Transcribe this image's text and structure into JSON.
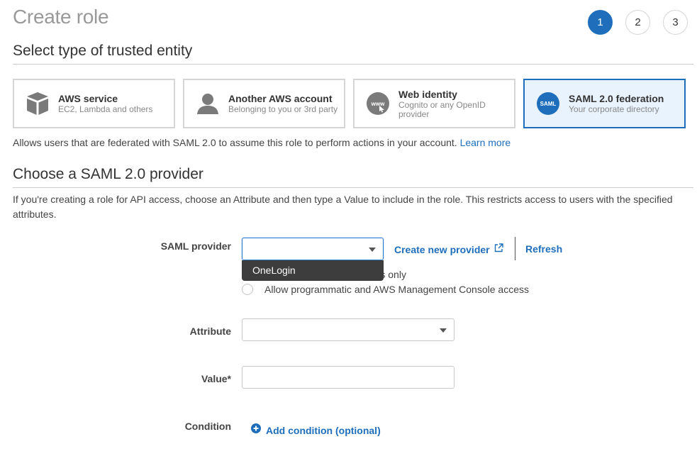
{
  "header": {
    "title": "Create role",
    "steps": [
      {
        "label": "1",
        "active": true
      },
      {
        "label": "2",
        "active": false
      },
      {
        "label": "3",
        "active": false
      }
    ]
  },
  "trusted_entity": {
    "section_title": "Select type of trusted entity",
    "cards": [
      {
        "title": "AWS service",
        "subtitle": "EC2, Lambda and others",
        "icon": "cube-icon",
        "selected": false
      },
      {
        "title": "Another AWS account",
        "subtitle": "Belonging to you or 3rd party",
        "icon": "user-icon",
        "selected": false
      },
      {
        "title": "Web identity",
        "subtitle": "Cognito or any OpenID provider",
        "icon": "www-icon",
        "icon_text": "www",
        "selected": false
      },
      {
        "title": "SAML 2.0 federation",
        "subtitle": "Your corporate directory",
        "icon": "saml-icon",
        "icon_text": "SAML",
        "selected": true
      }
    ],
    "description": "Allows users that are federated with SAML 2.0 to assume this role to perform actions in your account.",
    "learn_more": "Learn more"
  },
  "saml": {
    "section_title": "Choose a SAML 2.0 provider",
    "description": "If you're creating a role for API access, choose an Attribute and then type a Value to include in the role. This restricts access to users with the specified attributes.",
    "provider_label": "SAML provider",
    "provider_value": "",
    "provider_options": [
      "OneLogin"
    ],
    "create_provider": "Create new provider",
    "refresh": "Refresh",
    "access_options": [
      {
        "label": "Allow programmatic access only",
        "visible_text": "s only",
        "selected": false
      },
      {
        "label": "Allow programmatic and AWS Management Console access",
        "selected": false
      }
    ],
    "attribute_label": "Attribute",
    "attribute_value": "",
    "value_label": "Value*",
    "value_value": "",
    "condition_label": "Condition",
    "add_condition": "Add condition (optional)"
  },
  "colors": {
    "accent": "#1e6ebb",
    "selected_card_bg": "#e8f3fe",
    "dropdown_bg": "#3d3d3d"
  }
}
